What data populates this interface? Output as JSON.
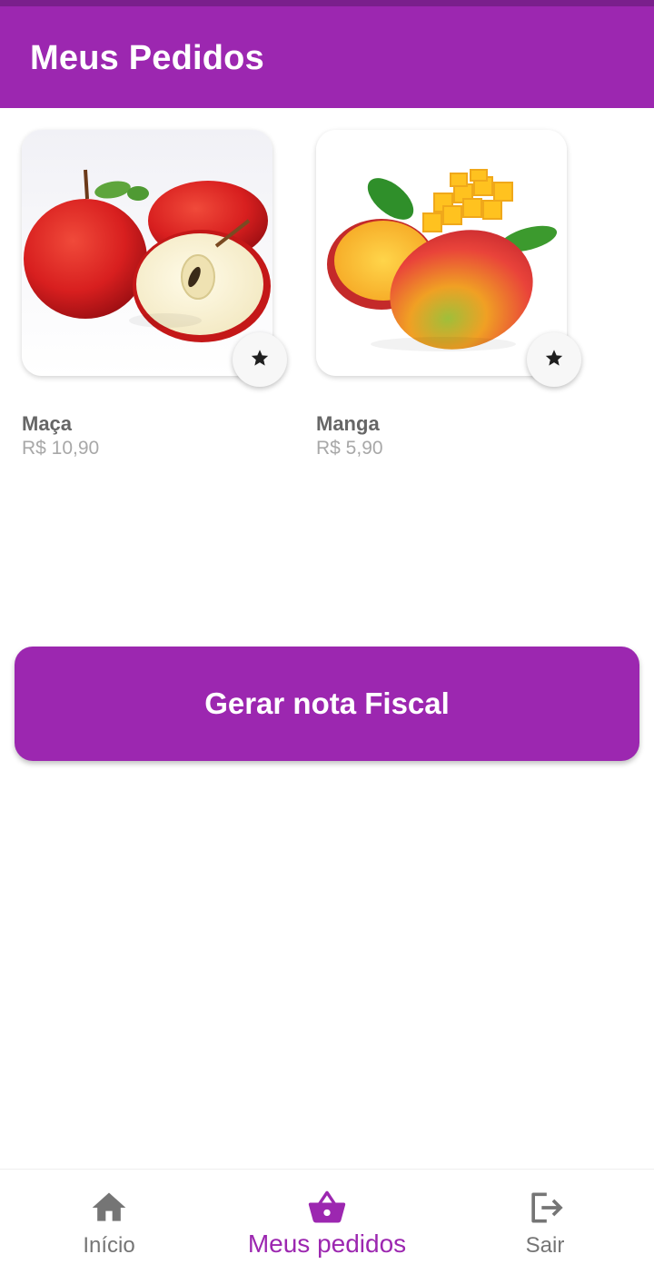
{
  "app_bar": {
    "title": "Meus Pedidos"
  },
  "products": [
    {
      "name": "Maça",
      "price": "R$ 10,90",
      "image": "apple",
      "favorite_icon": "star-icon"
    },
    {
      "name": "Manga",
      "price": "R$ 5,90",
      "image": "mango",
      "favorite_icon": "star-icon"
    }
  ],
  "actions": {
    "invoice_label": "Gerar nota Fiscal"
  },
  "bottom_nav": {
    "items": [
      {
        "label": "Início",
        "icon": "home-icon",
        "active": false
      },
      {
        "label": "Meus pedidos",
        "icon": "basket-icon",
        "active": true
      },
      {
        "label": "Sair",
        "icon": "logout-icon",
        "active": false
      }
    ]
  },
  "colors": {
    "primary": "#9c27b0",
    "status_bar": "#7a1f8c",
    "inactive": "#757575"
  }
}
